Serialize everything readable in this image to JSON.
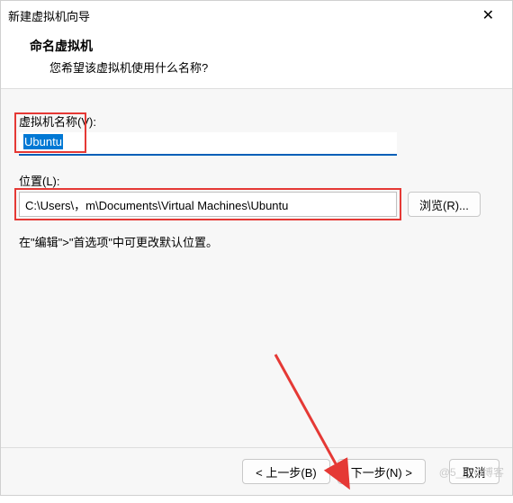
{
  "window": {
    "title": "新建虚拟机向导"
  },
  "header": {
    "title": "命名虚拟机",
    "subtitle": "您希望该虚拟机使用什么名称?"
  },
  "fields": {
    "vmname_label": "虚拟机名称(V):",
    "vmname_value": "Ubuntu",
    "location_label": "位置(L):",
    "location_value": "C:\\Users\\，m\\Documents\\Virtual Machines\\Ubuntu",
    "browse_label": "浏览(R)..."
  },
  "hint": "在\"编辑\">\"首选项\"中可更改默认位置。",
  "footer": {
    "back": "< 上一步(B)",
    "next": "下一步(N) >",
    "cancel": "取消"
  },
  "watermark": "@5___O博客"
}
